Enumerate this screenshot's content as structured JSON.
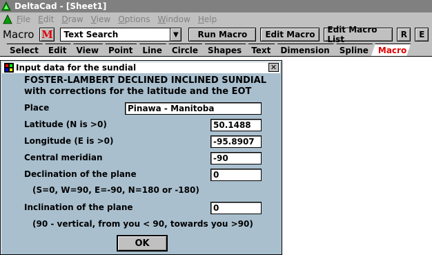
{
  "window": {
    "title": "DeltaCad - [Sheet1]",
    "app_icon": "deltacad-icon"
  },
  "menubar": {
    "items": [
      {
        "label": "File",
        "hotkey": "F",
        "rest": "ile"
      },
      {
        "label": "Edit",
        "hotkey": "E",
        "rest": "dit"
      },
      {
        "label": "Draw",
        "hotkey": "D",
        "rest": "raw"
      },
      {
        "label": "View",
        "hotkey": "V",
        "rest": "iew"
      },
      {
        "label": "Options",
        "hotkey": "O",
        "rest": "ptions"
      },
      {
        "label": "Window",
        "hotkey": "W",
        "rest": "indow"
      },
      {
        "label": "Help",
        "hotkey": "H",
        "rest": "elp"
      }
    ]
  },
  "toolbar": {
    "macro_label": "Macro",
    "m_button": "M",
    "combo_value": "Text Search",
    "combo_arrow": "▼",
    "run_macro": "Run Macro",
    "edit_macro": "Edit Macro",
    "edit_macro_list": "Edit Macro List",
    "r_button": "R",
    "e_button": "E"
  },
  "tabs": [
    {
      "label": "Select",
      "active": false
    },
    {
      "label": "Edit",
      "active": false
    },
    {
      "label": "View",
      "active": false
    },
    {
      "label": "Point",
      "active": false
    },
    {
      "label": "Line",
      "active": false
    },
    {
      "label": "Circle",
      "active": false
    },
    {
      "label": "Shapes",
      "active": false
    },
    {
      "label": "Text",
      "active": false
    },
    {
      "label": "Dimension",
      "active": false
    },
    {
      "label": "Spline",
      "active": false
    },
    {
      "label": "Macro",
      "active": true
    }
  ],
  "dialog": {
    "title": "Input data for the sundial",
    "close": "✕",
    "heading1": "FOSTER-LAMBERT DECLINED INCLINED SUNDIAL",
    "heading2": "with corrections for the latitude and the EOT",
    "place_label": "Place",
    "place_value": "Pinawa - Manitoba",
    "latitude_label": "Latitude (N is >0)",
    "latitude_value": "50.1488",
    "longitude_label": "Longitude (E is >0)",
    "longitude_value": "-95.8907",
    "meridian_label": "Central meridian",
    "meridian_value": "-90",
    "declination_label": "Declination of the plane",
    "declination_value": "0",
    "declination_hint": "(S=0, W=90, E=-90, N=180 or -180)",
    "inclination_label": "Inclination of the plane",
    "inclination_value": "0",
    "inclination_hint": "(90 - vertical, from you < 90, towards you >90)",
    "ok": "OK"
  },
  "colors": {
    "accent_red": "#e00000",
    "dialog_bg": "#a9bfce",
    "chrome_gray": "#c0c0c0",
    "title_gray": "#808080"
  }
}
